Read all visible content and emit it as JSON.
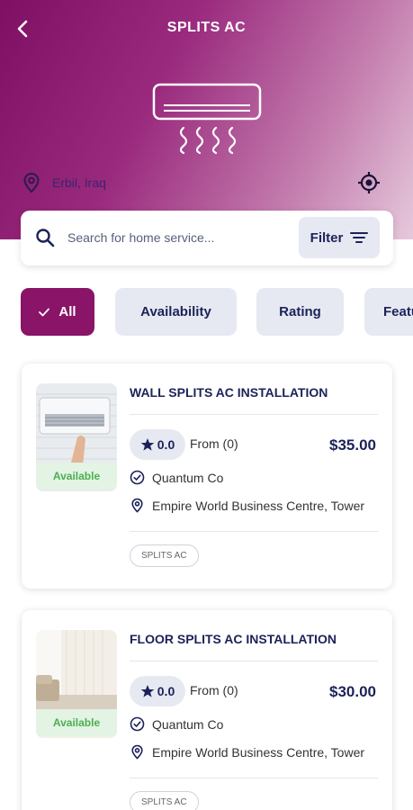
{
  "header": {
    "title": "SPLITS AC",
    "back_icon": "back-chevron-icon",
    "illustration_icon": "air-conditioner-icon",
    "location": "Erbil, Iraq",
    "location_icon": "map-pin-icon",
    "gps_icon": "crosshair-icon"
  },
  "search": {
    "placeholder": "Search for home service...",
    "value": "",
    "filter_label": "Filter"
  },
  "chips": [
    {
      "label": "All",
      "active": true
    },
    {
      "label": "Availability",
      "active": false
    },
    {
      "label": "Rating",
      "active": false
    },
    {
      "label": "Featured",
      "active": false
    }
  ],
  "services": [
    {
      "title": "WALL SPLITS AC INSTALLATION",
      "availability": "Available",
      "rating": "0.0",
      "from": "From (0)",
      "price": "$35.00",
      "provider": "Quantum Co",
      "address": "Empire World Business Centre, Tower",
      "tag": "SPLITS AC"
    },
    {
      "title": "FLOOR SPLITS AC INSTALLATION",
      "availability": "Available",
      "rating": "0.0",
      "from": "From (0)",
      "price": "$30.00",
      "provider": "Quantum Co",
      "address": "Empire World Business Centre, Tower",
      "tag": "SPLITS AC"
    }
  ],
  "colors": {
    "brand": "#8a1468",
    "navy": "#1c2259",
    "chip_bg": "#e6e9f1",
    "available_green": "#4caf50"
  }
}
